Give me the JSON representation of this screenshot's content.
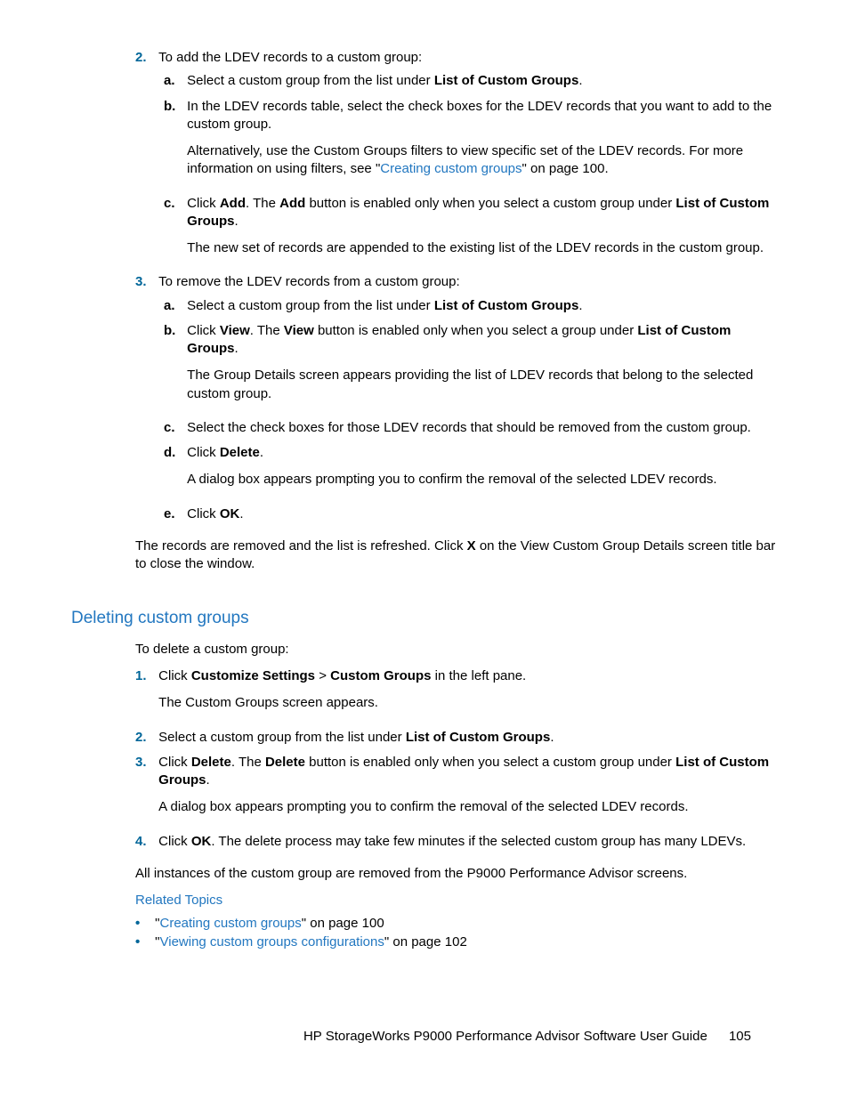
{
  "step2": {
    "num": "2.",
    "text": "To add the LDEV records to a custom group:",
    "a": {
      "m": "a.",
      "pre": "Select a custom group from the list under ",
      "bold": "List of Custom Groups",
      "post": "."
    },
    "b": {
      "m": "b.",
      "text": "In the LDEV records table, select the check boxes for the LDEV records that you want to add to the custom group.",
      "p2_pre": "Alternatively, use the Custom Groups filters to view specific set of the LDEV records. For more information on using filters, see \"",
      "p2_link": "Creating custom groups",
      "p2_post": "\" on page 100."
    },
    "c": {
      "m": "c.",
      "t1": "Click ",
      "b1": "Add",
      "t2": ". The ",
      "b2": "Add",
      "t3": " button is enabled only when you select a custom group under ",
      "b3": "List of Custom Groups",
      "t4": ".",
      "p2": "The new set of records are appended to the existing list of the LDEV records in the custom group."
    }
  },
  "step3": {
    "num": "3.",
    "text": "To remove the LDEV records from a custom group:",
    "a": {
      "m": "a.",
      "pre": "Select a custom group from the list under ",
      "bold": "List of Custom Groups",
      "post": "."
    },
    "b": {
      "m": "b.",
      "t1": "Click ",
      "b1": "View",
      "t2": ". The ",
      "b2": "View",
      "t3": " button is enabled only when you select a group under ",
      "b3": "List of Custom Groups",
      "t4": ".",
      "p2": "The Group Details screen appears providing the list of LDEV records that belong to the selected custom group."
    },
    "c": {
      "m": "c.",
      "text": "Select the check boxes for those LDEV records that should be removed from the custom group."
    },
    "d": {
      "m": "d.",
      "t1": "Click ",
      "b1": "Delete",
      "t2": ".",
      "p2": "A dialog box appears prompting you to confirm the removal of the selected LDEV records."
    },
    "e": {
      "m": "e.",
      "t1": "Click ",
      "b1": "OK",
      "t2": "."
    }
  },
  "afterSteps": {
    "t1": "The records are removed and the list is refreshed. Click ",
    "b1": "X",
    "t2": " on the View Custom Group Details screen title bar to close the window."
  },
  "section2": {
    "title": "Deleting custom groups",
    "intro": "To delete a custom group:",
    "s1": {
      "num": "1.",
      "t1": "Click ",
      "b1": "Customize Settings",
      "t2": " > ",
      "b2": "Custom Groups",
      "t3": " in the left pane.",
      "p2": "The Custom Groups screen appears."
    },
    "s2": {
      "num": "2.",
      "pre": "Select a custom group from the list under ",
      "bold": "List of Custom Groups",
      "post": "."
    },
    "s3": {
      "num": "3.",
      "t1": "Click ",
      "b1": "Delete",
      "t2": ". The ",
      "b2": "Delete",
      "t3": " button is enabled only when you select a custom group under ",
      "b3": "List of Custom Groups",
      "t4": ".",
      "p2": "A dialog box appears prompting you to confirm the removal of the selected LDEV records."
    },
    "s4": {
      "num": "4.",
      "t1": "Click ",
      "b1": "OK",
      "t2": ". The delete process may take few minutes if the selected custom group has many LDEVs."
    },
    "closing": "All instances of the custom group are removed from the P9000 Performance Advisor screens.",
    "related": "Related Topics",
    "bul1": {
      "q1": "\"",
      "link": "Creating custom groups",
      "q2": "\" on page 100"
    },
    "bul2": {
      "q1": "\"",
      "link": "Viewing custom groups configurations",
      "q2": "\" on page 102"
    }
  },
  "footer": {
    "title": "HP StorageWorks P9000 Performance Advisor Software User Guide",
    "page": "105"
  }
}
